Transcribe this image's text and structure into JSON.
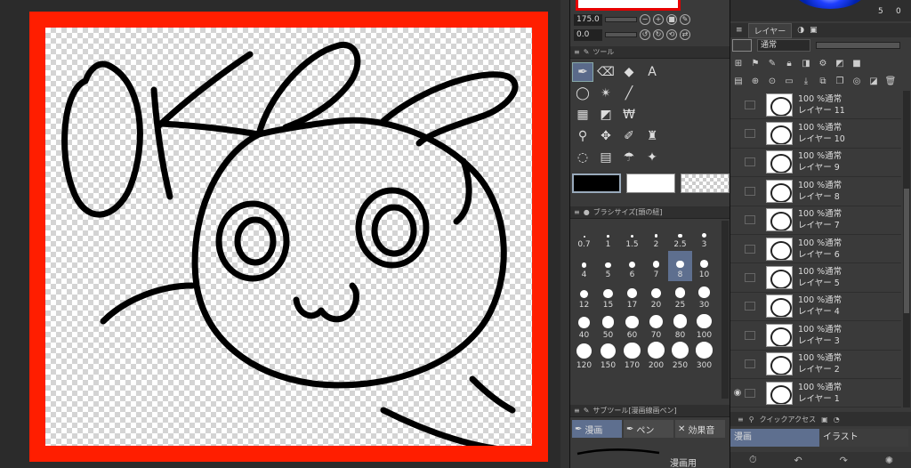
{
  "toolbar": {
    "brush_size_value": "175.0",
    "opacity_value": "0.0"
  },
  "tool_panel": {
    "title": "ツール"
  },
  "brush_size_panel": {
    "title": "ブラシサイズ[頭の紐]",
    "sizes": [
      "0.7",
      "1",
      "1.5",
      "2",
      "2.5",
      "3",
      "4",
      "5",
      "6",
      "7",
      "8",
      "10",
      "12",
      "15",
      "17",
      "20",
      "25",
      "30",
      "40",
      "50",
      "60",
      "70",
      "80",
      "100",
      "120",
      "150",
      "170",
      "200",
      "250",
      "300"
    ],
    "selected": "8"
  },
  "sub_tool_panel": {
    "title": "サブツール[漫画線画ペン]",
    "tabs": [
      "漫画",
      "ペン",
      "効果音"
    ],
    "active_tab": "漫画",
    "stroke_label": "漫画用"
  },
  "right_top": {
    "number_left": "5",
    "number_right": "0"
  },
  "layer_panel": {
    "tab_label": "レイヤー",
    "blend_mode": "通常",
    "layers": [
      {
        "opacity": "100 %通常",
        "name": "レイヤー 11",
        "visible": false
      },
      {
        "opacity": "100 %通常",
        "name": "レイヤー 10",
        "visible": false
      },
      {
        "opacity": "100 %通常",
        "name": "レイヤー 9",
        "visible": false
      },
      {
        "opacity": "100 %通常",
        "name": "レイヤー 8",
        "visible": false
      },
      {
        "opacity": "100 %通常",
        "name": "レイヤー 7",
        "visible": false
      },
      {
        "opacity": "100 %通常",
        "name": "レイヤー 6",
        "visible": false
      },
      {
        "opacity": "100 %通常",
        "name": "レイヤー 5",
        "visible": false
      },
      {
        "opacity": "100 %通常",
        "name": "レイヤー 4",
        "visible": false
      },
      {
        "opacity": "100 %通常",
        "name": "レイヤー 3",
        "visible": false
      },
      {
        "opacity": "100 %通常",
        "name": "レイヤー 2",
        "visible": false
      },
      {
        "opacity": "100 %通常",
        "name": "レイヤー 1",
        "visible": true
      }
    ]
  },
  "quick_access": {
    "title": "クイックアクセス",
    "tabs": [
      "漫画",
      "イラスト"
    ],
    "active_tab": "漫画"
  },
  "colors": {
    "frame_red": "#ff1e00",
    "selection_blue": "#5e6f8f"
  }
}
